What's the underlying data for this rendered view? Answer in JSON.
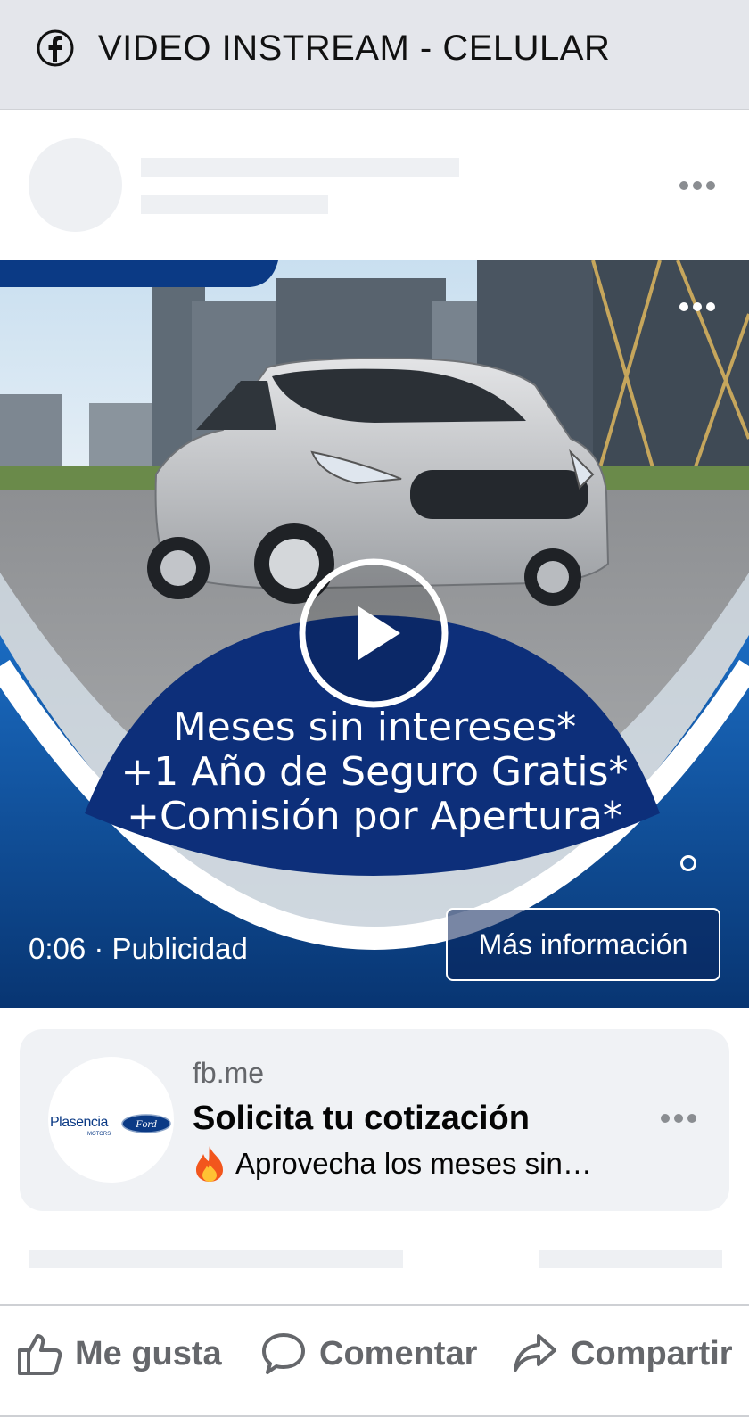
{
  "header": {
    "title": "VIDEO INSTREAM - CELULAR",
    "icon": "facebook-icon"
  },
  "ad": {
    "promo_lines": [
      "Meses sin intereses*",
      "+1 Año de Seguro Gratis*",
      "+Comisión por Apertura*"
    ],
    "timestamp": "0:06 · Publicidad",
    "cta_label": "Más información"
  },
  "link_card": {
    "domain": "fb.me",
    "title": "Solicita tu cotización",
    "description": "Aprovecha los meses sin…",
    "logo_text": "Plasencia"
  },
  "actions": {
    "like": "Me gusta",
    "comment": "Comentar",
    "share": "Compartir"
  },
  "colors": {
    "header_bg": "#e4e6eb",
    "ford_blue": "#0b3a85",
    "muted_text": "#65676b"
  }
}
